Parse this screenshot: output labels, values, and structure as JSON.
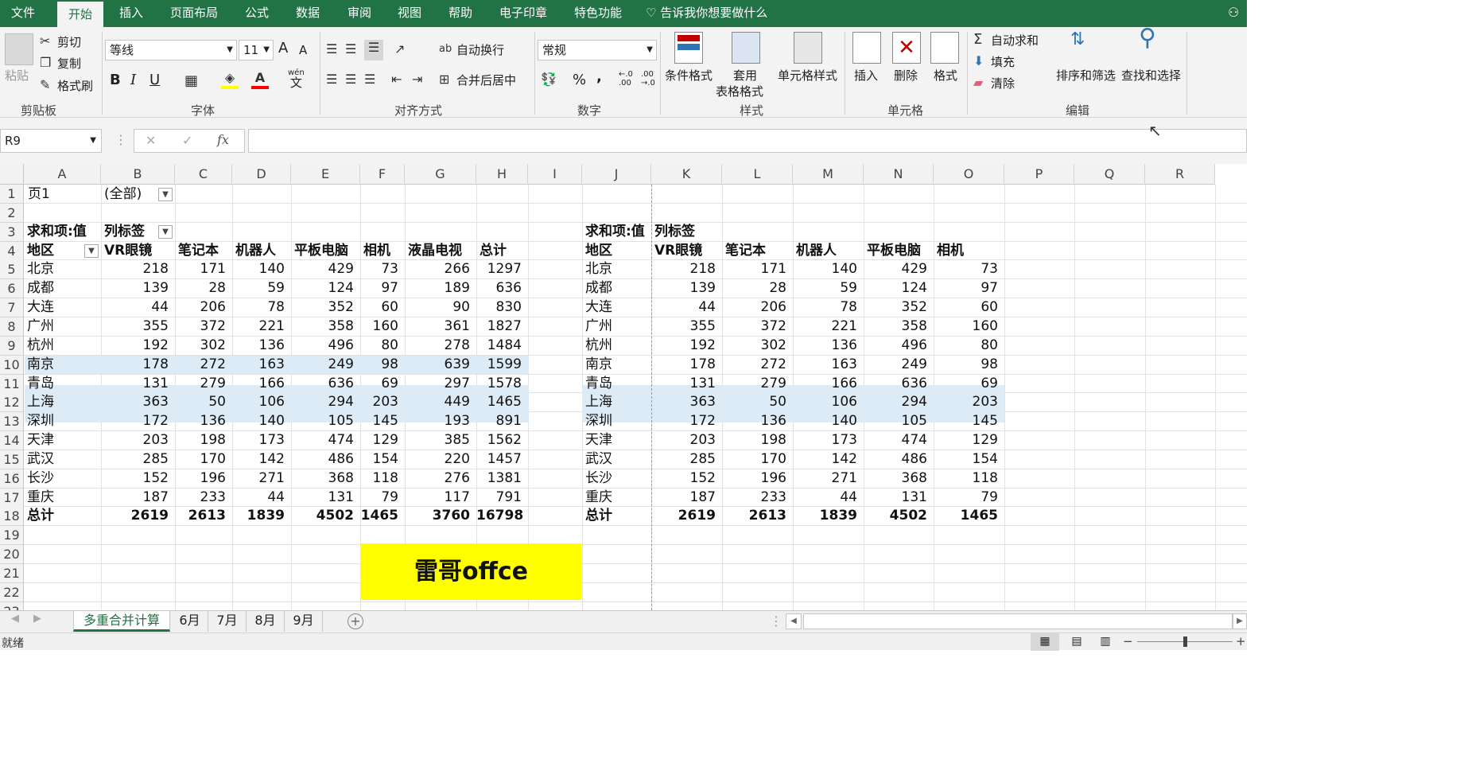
{
  "menu": {
    "tabs": [
      "文件",
      "开始",
      "插入",
      "页面布局",
      "公式",
      "数据",
      "审阅",
      "视图",
      "帮助",
      "电子印章",
      "特色功能"
    ],
    "active": "开始",
    "tell_me": "告诉我你想要做什么"
  },
  "ribbon": {
    "clipboard": {
      "paste": "粘贴",
      "cut": "剪切",
      "copy": "复制",
      "format_painter": "格式刷",
      "label": "剪贴板"
    },
    "font": {
      "name": "等线",
      "size": "11",
      "label": "字体",
      "increase": "A",
      "decrease": "A",
      "bold": "B",
      "italic": "I",
      "underline": "U",
      "phonetic_top": "wén",
      "phonetic": "文"
    },
    "alignment": {
      "wrap": "自动换行",
      "merge": "合并后居中",
      "label": "对齐方式"
    },
    "number": {
      "format": "常规",
      "label": "数字",
      "percent": "%",
      "comma": ",",
      "inc_decimal_top": "←.0",
      "inc_decimal_bottom": ".00",
      "dec_decimal_top": ".00",
      "dec_decimal_bottom": "→.0"
    },
    "styles": {
      "conditional": "条件格式",
      "table_top": "套用",
      "table_bottom": "表格格式",
      "cell_style": "单元格样式",
      "label": "样式"
    },
    "cells": {
      "insert": "插入",
      "delete": "删除",
      "format": "格式",
      "label": "单元格"
    },
    "editing": {
      "autosum": "自动求和",
      "fill": "填充",
      "clear": "清除",
      "sort": "排序和筛选",
      "find": "查找和选择",
      "label": "编辑"
    }
  },
  "formula_bar": {
    "name_box": "R9",
    "fx": "fx",
    "content": ""
  },
  "grid": {
    "columns": [
      "A",
      "B",
      "C",
      "D",
      "E",
      "F",
      "G",
      "H",
      "I",
      "J",
      "K",
      "L",
      "M",
      "N",
      "O",
      "P",
      "Q",
      "R"
    ],
    "rows": [
      "1",
      "2",
      "3",
      "4",
      "5",
      "6",
      "7",
      "8",
      "9",
      "10",
      "11",
      "12",
      "13",
      "14",
      "15",
      "16",
      "17",
      "18",
      "19",
      "20",
      "21",
      "22",
      "23"
    ],
    "page_filter": {
      "label": "页1",
      "value": "(全部)"
    },
    "pivot_left": {
      "value_label": "求和项:值",
      "col_label": "列标签",
      "row_label": "地区",
      "headers": [
        "VR眼镜",
        "笔记本",
        "机器人",
        "平板电脑",
        "相机",
        "液晶电视",
        "总计"
      ],
      "rows": [
        [
          "北京",
          218,
          171,
          140,
          429,
          73,
          266,
          1297
        ],
        [
          "成都",
          139,
          28,
          59,
          124,
          97,
          189,
          636
        ],
        [
          "大连",
          44,
          206,
          78,
          352,
          60,
          90,
          830
        ],
        [
          "广州",
          355,
          372,
          221,
          358,
          160,
          361,
          1827
        ],
        [
          "杭州",
          192,
          302,
          136,
          496,
          80,
          278,
          1484
        ],
        [
          "南京",
          178,
          272,
          163,
          249,
          98,
          639,
          1599
        ],
        [
          "青岛",
          131,
          279,
          166,
          636,
          69,
          297,
          1578
        ],
        [
          "上海",
          363,
          50,
          106,
          294,
          203,
          449,
          1465
        ],
        [
          "深圳",
          172,
          136,
          140,
          105,
          145,
          193,
          891
        ],
        [
          "天津",
          203,
          198,
          173,
          474,
          129,
          385,
          1562
        ],
        [
          "武汉",
          285,
          170,
          142,
          486,
          154,
          220,
          1457
        ],
        [
          "长沙",
          152,
          196,
          271,
          368,
          118,
          276,
          1381
        ],
        [
          "重庆",
          187,
          233,
          44,
          131,
          79,
          117,
          791
        ]
      ],
      "total": [
        "总计",
        2619,
        2613,
        1839,
        4502,
        1465,
        3760,
        16798
      ]
    },
    "pivot_right": {
      "value_label": "求和项:值",
      "col_label": "列标签",
      "row_label": "地区",
      "headers": [
        "VR眼镜",
        "笔记本",
        "机器人",
        "平板电脑",
        "相机"
      ],
      "rows": [
        [
          "北京",
          218,
          171,
          140,
          429,
          73
        ],
        [
          "成都",
          139,
          28,
          59,
          124,
          97
        ],
        [
          "大连",
          44,
          206,
          78,
          352,
          60
        ],
        [
          "广州",
          355,
          372,
          221,
          358,
          160
        ],
        [
          "杭州",
          192,
          302,
          136,
          496,
          80
        ],
        [
          "南京",
          178,
          272,
          163,
          249,
          98
        ],
        [
          "青岛",
          131,
          279,
          166,
          636,
          69
        ],
        [
          "上海",
          363,
          50,
          106,
          294,
          203
        ],
        [
          "深圳",
          172,
          136,
          140,
          105,
          145
        ],
        [
          "天津",
          203,
          198,
          173,
          474,
          129
        ],
        [
          "武汉",
          285,
          170,
          142,
          486,
          154
        ],
        [
          "长沙",
          152,
          196,
          271,
          368,
          118
        ],
        [
          "重庆",
          187,
          233,
          44,
          131,
          79
        ]
      ],
      "total": [
        "总计",
        2619,
        2613,
        1839,
        4502,
        1465
      ]
    },
    "banner": {
      "text": "雷哥offce",
      "bg": "#ffff00"
    }
  },
  "sheets": {
    "tabs": [
      "多重合并计算",
      "6月",
      "7月",
      "8月",
      "9月"
    ],
    "active": "多重合并计算"
  },
  "status": {
    "text": "就绪"
  },
  "colors": {
    "accent": "#217346",
    "pivot_band": "#ddebf7"
  }
}
